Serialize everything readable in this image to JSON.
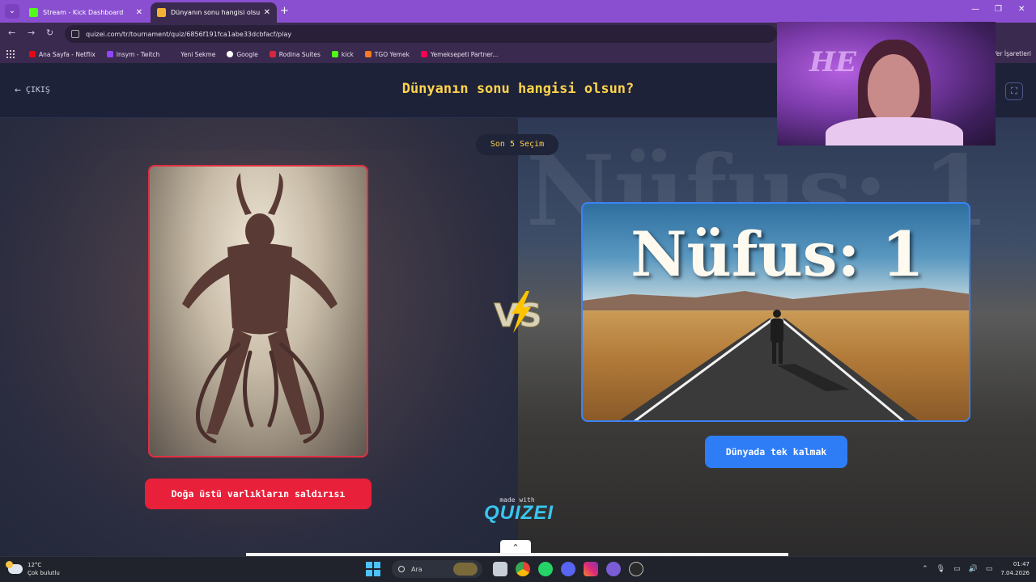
{
  "browser": {
    "tabs": [
      {
        "title": "Stream - Kick Dashboard",
        "favicon": "kick-icon"
      },
      {
        "title": "Dünyanın sonu hangisi olsun?",
        "favicon": "quizei-icon",
        "active": true
      }
    ],
    "url": "quizei.com/tr/tournament/quiz/6856f191fca1abe33dcbfacf/play",
    "bookmarks": [
      "Ana Sayfa - Netflix",
      "Insym - Twitch",
      "Yeni Sekme",
      "Google",
      "Rodina Suites",
      "kick",
      "TGO Yemek",
      "Yemeksepeti Partner..."
    ],
    "bookmarks_right": "Yer İşaretleri"
  },
  "quiz": {
    "exit_label": "ÇIKIŞ",
    "title": "Dünyanın sonu hangisi olsun?",
    "recent_choices": "Son 5 Seçim",
    "left_option": "Doğa üstü varlıkların saldırısı",
    "right_option": "Dünyada tek kalmak",
    "right_image_text": "Nüfus: 1",
    "vs_label": "VS",
    "made_with": "made with",
    "brand": "QUIZEI"
  },
  "taskbar": {
    "weather_temp": "12°C",
    "weather_desc": "Çok bulutlu",
    "search_placeholder": "Ara",
    "time": "01:47",
    "date": "7.04.2026"
  },
  "colors": {
    "accent_yellow": "#ffd34d",
    "left_red": "#e8203a",
    "right_blue": "#2f7df6",
    "tabbar_purple": "#8a4fd0"
  }
}
